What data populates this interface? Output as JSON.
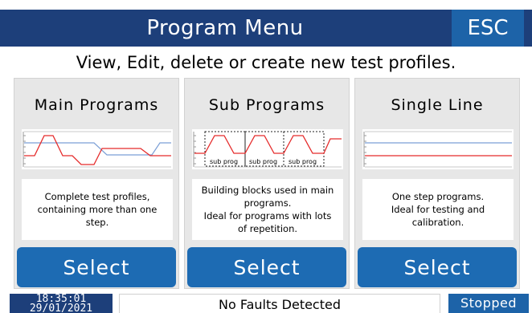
{
  "header": {
    "title": "Program Menu",
    "esc_label": "ESC"
  },
  "subtitle": "View, Edit, delete or create new test profiles.",
  "cards": [
    {
      "title": "Main Programs",
      "description": "Complete test profiles,\ncontaining more than one\nstep.",
      "select_label": "Select"
    },
    {
      "title": "Sub Programs",
      "description": "Building blocks used in main\nprograms.\nIdeal for programs with lots\nof repetition.",
      "select_label": "Select",
      "graph_labels": [
        "sub prog",
        "sub prog",
        "sub prog"
      ]
    },
    {
      "title": "Single Line",
      "description": "One step programs.\nIdeal for testing and\ncalibration.",
      "select_label": "Select"
    }
  ],
  "footer": {
    "time": "18:35:01",
    "date": "29/01/2021",
    "fault_status": "No Faults Detected",
    "run_status": "Stopped"
  },
  "colors": {
    "header_bg": "#1d3f7a",
    "button_bg": "#1d6bb3",
    "red_trace": "#e52b2b",
    "blue_trace": "#7b9fd6"
  }
}
